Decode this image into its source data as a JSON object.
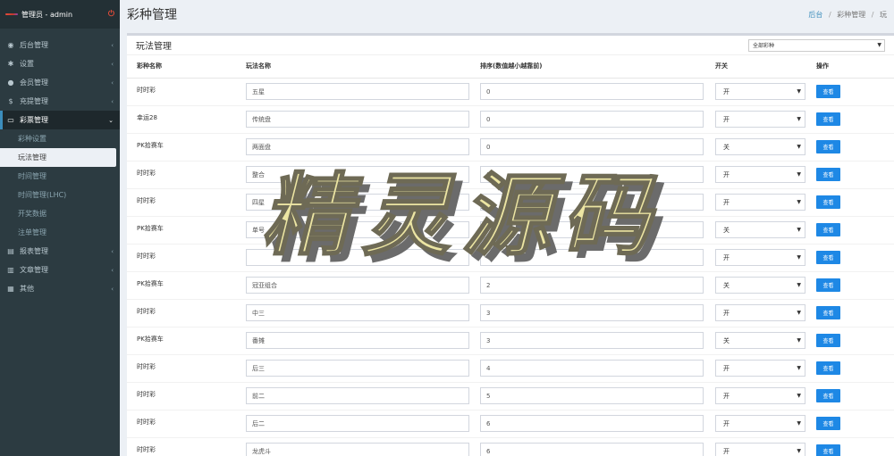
{
  "sidebar": {
    "user": "管理员 - admin",
    "items": [
      {
        "icon": "dashboard-icon",
        "glyph": "◉",
        "label": "后台管理"
      },
      {
        "icon": "gear-icon",
        "glyph": "✱",
        "label": "设置"
      },
      {
        "icon": "user-icon",
        "glyph": "●",
        "label": "会员管理"
      },
      {
        "icon": "dollar-icon",
        "glyph": "$",
        "label": "充提管理"
      },
      {
        "icon": "lottery-icon",
        "glyph": "▭",
        "label": "彩票管理"
      },
      {
        "icon": "report-icon",
        "glyph": "▤",
        "label": "报表管理"
      },
      {
        "icon": "book-icon",
        "glyph": "▥",
        "label": "文章管理"
      },
      {
        "icon": "grid-icon",
        "glyph": "▦",
        "label": "其他"
      }
    ],
    "subitems": [
      "彩种设置",
      "玩法管理",
      "时间管理",
      "时间管理(LHC)",
      "开奖数据",
      "注单管理"
    ]
  },
  "header": {
    "title": "彩种管理",
    "breadcrumb": [
      "后台",
      "彩种管理",
      "玩"
    ]
  },
  "box": {
    "title": "玩法管理",
    "filter": "全部彩种"
  },
  "table": {
    "columns": [
      "彩种名称",
      "玩法名称",
      "排序(数值越小越靠前)",
      "开关",
      "操作"
    ],
    "view_label": "查看",
    "rows": [
      {
        "cat": "时时彩",
        "name": "五星",
        "sort": "0",
        "sw": "开"
      },
      {
        "cat": "幸运28",
        "name": "传统盘",
        "sort": "0",
        "sw": "开"
      },
      {
        "cat": "PK拾赛车",
        "name": "两面盘",
        "sort": "0",
        "sw": "关"
      },
      {
        "cat": "时时彩",
        "name": "整合",
        "sort": "0",
        "sw": "开"
      },
      {
        "cat": "时时彩",
        "name": "四星",
        "sort": "",
        "sw": "开"
      },
      {
        "cat": "PK拾赛车",
        "name": "单号",
        "sort": "",
        "sw": "关"
      },
      {
        "cat": "时时彩",
        "name": "",
        "sort": "",
        "sw": "开"
      },
      {
        "cat": "PK拾赛车",
        "name": "冠亚组合",
        "sort": "2",
        "sw": "关"
      },
      {
        "cat": "时时彩",
        "name": "中三",
        "sort": "3",
        "sw": "开"
      },
      {
        "cat": "PK拾赛车",
        "name": "番摊",
        "sort": "3",
        "sw": "关"
      },
      {
        "cat": "时时彩",
        "name": "后三",
        "sort": "4",
        "sw": "开"
      },
      {
        "cat": "时时彩",
        "name": "前二",
        "sort": "5",
        "sw": "开"
      },
      {
        "cat": "时时彩",
        "name": "后二",
        "sort": "6",
        "sw": "开"
      },
      {
        "cat": "时时彩",
        "name": "龙虎斗",
        "sort": "6",
        "sw": "开"
      }
    ]
  },
  "watermark": "精灵源码"
}
